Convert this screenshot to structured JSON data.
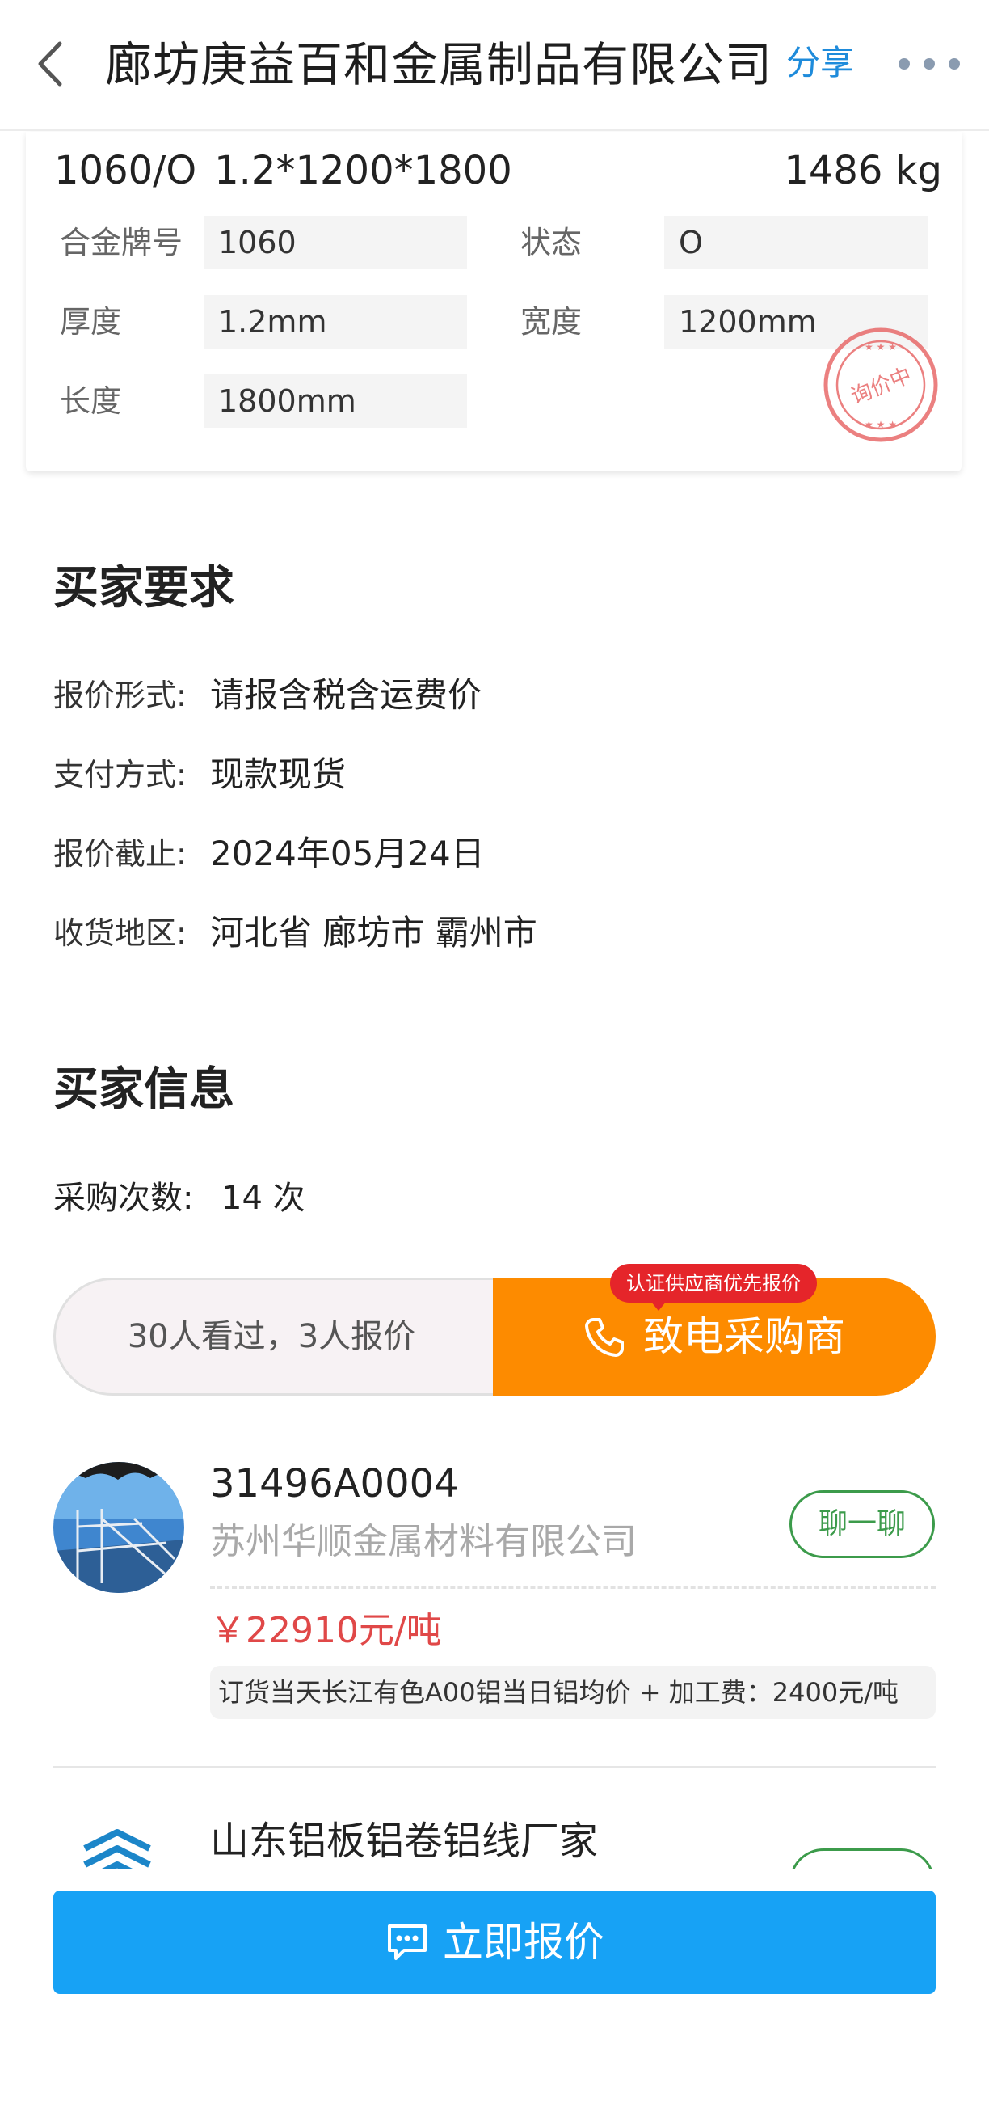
{
  "header": {
    "title": "廊坊庚益百和金属制品有限公司",
    "share_label": "分享"
  },
  "product": {
    "grade_state": "1060/O",
    "spec": "1.2*1200*1800",
    "weight": "1486 kg",
    "attributes": [
      {
        "label": "合金牌号",
        "value": "1060"
      },
      {
        "label": "状态",
        "value": "O"
      },
      {
        "label": "厚度",
        "value": "1.2mm"
      },
      {
        "label": "宽度",
        "value": "1200mm"
      },
      {
        "label": "长度",
        "value": "1800mm"
      }
    ],
    "stamp_text": "询价中"
  },
  "requirements": {
    "title": "买家要求",
    "items": [
      {
        "label": "报价形式:",
        "value": "请报含税含运费价"
      },
      {
        "label": "支付方式:",
        "value": "现款现货"
      },
      {
        "label": "报价截止:",
        "value": "2024年05月24日"
      },
      {
        "label": "收货地区:",
        "value": "河北省 廊坊市 霸州市"
      }
    ]
  },
  "buyer_info": {
    "title": "买家信息",
    "purchase_count_label": "采购次数:",
    "purchase_count_value": "14 次"
  },
  "actions": {
    "views_text": "30人看过，3人报价",
    "call_label": "致电采购商",
    "call_badge": "认证供应商优先报价"
  },
  "quotes": [
    {
      "id": "31496A0004",
      "company": "苏州华顺金属材料有限公司",
      "chat_label": "聊一聊",
      "price": "￥22910元/吨",
      "note": "订货当天长江有色A00铝当日铝均价 + 加工费：2400元/吨"
    },
    {
      "company": "山东铝板铝卷铝线厂家"
    }
  ],
  "bottom": {
    "quote_now_label": "立即报价"
  },
  "colors": {
    "accent_blue": "#17a2f5",
    "call_orange": "#fd8b00",
    "price_red": "#e04848",
    "chat_green": "#3c9b4b"
  }
}
